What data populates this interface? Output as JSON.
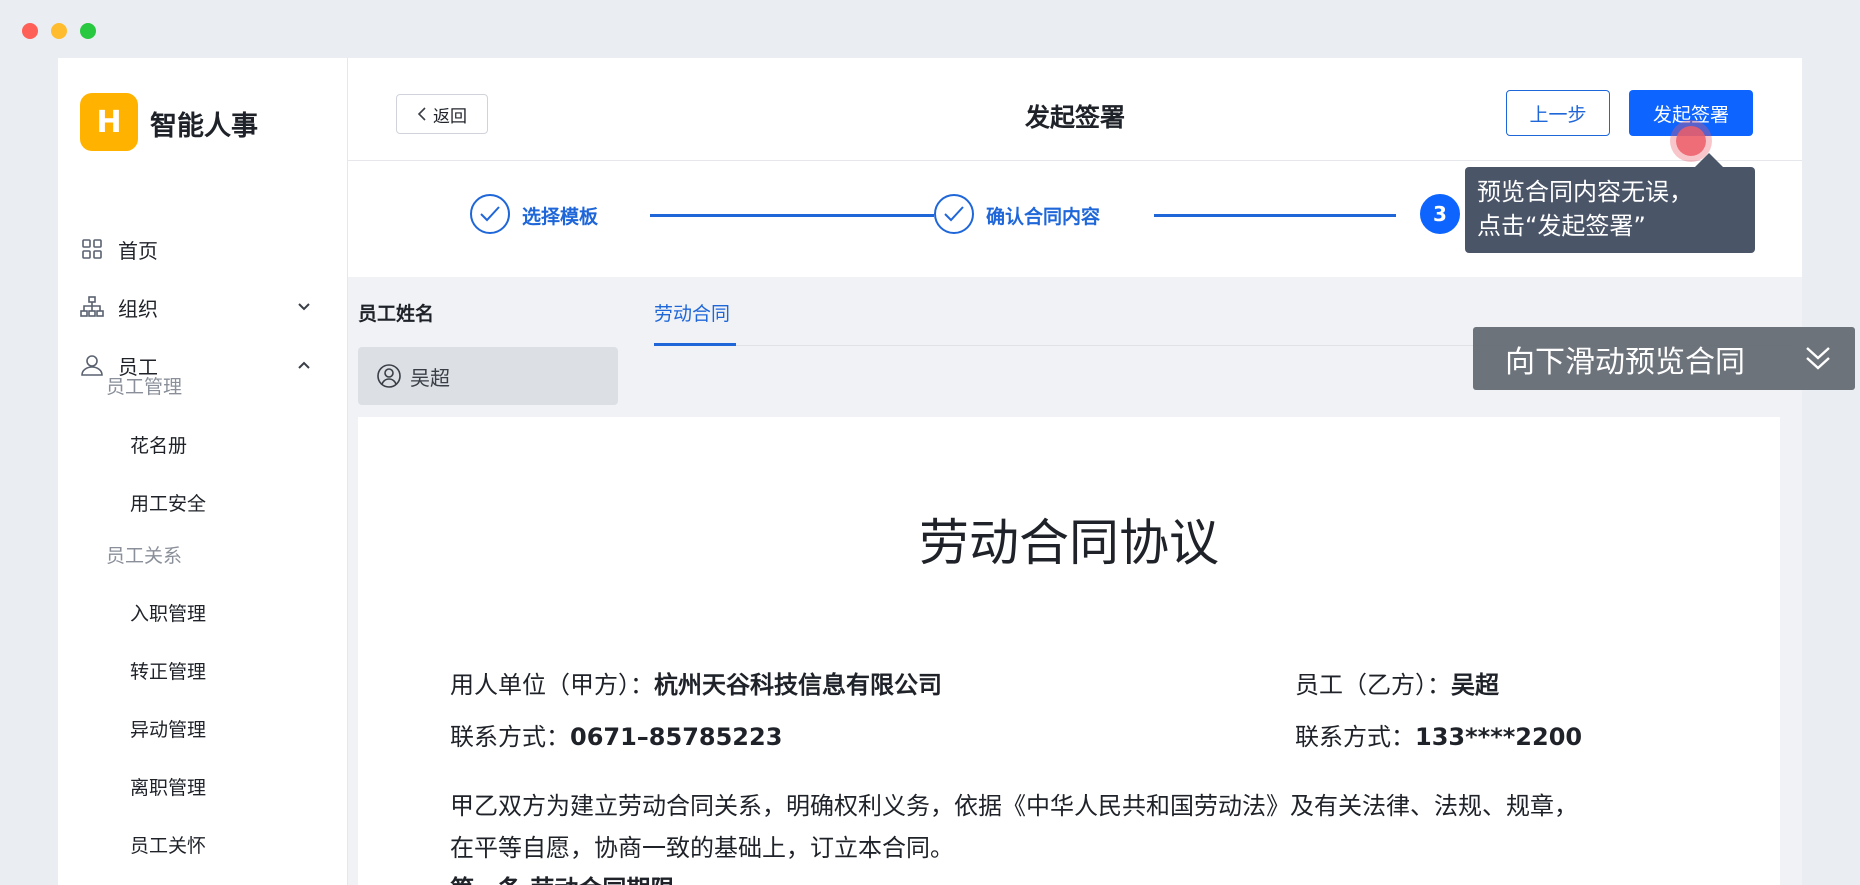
{
  "app": {
    "logo_letter": "H",
    "name": "智能人事",
    "brand_color": "#ffb300",
    "accent": "#1f67d9"
  },
  "sidebar": {
    "home": "首页",
    "org": "组织",
    "employee": "员工",
    "group_manage": "员工管理",
    "roster": "花名册",
    "safety": "用工安全",
    "group_relation": "员工关系",
    "onboard": "入职管理",
    "regular": "转正管理",
    "transfer": "异动管理",
    "leave": "离职管理",
    "care": "员工关怀"
  },
  "header": {
    "back": "返回",
    "title": "发起签署",
    "prev": "上一步",
    "submit": "发起签署"
  },
  "steps": {
    "s1": "选择模板",
    "s2": "确认合同内容",
    "s3_number": "3"
  },
  "tooltip": {
    "line1": "预览合同内容无误，",
    "line2": "点击“发起签署”"
  },
  "scroll_hint": "向下滑动预览合同",
  "content": {
    "col_emp": "员工姓名",
    "tab": "劳动合同",
    "employee": "吴超"
  },
  "doc": {
    "title": "劳动合同协议",
    "party_a_label": "用人单位（甲方）：",
    "party_a": "杭州天谷科技信息有限公司",
    "party_b_label": "员工（乙方）：",
    "party_b": "吴超",
    "contact_a_label": "联系方式：",
    "contact_a": "0671–85785223",
    "contact_b_label": "联系方式：",
    "contact_b": "133****2200",
    "para_line1": "甲乙双方为建立劳动合同关系，明确权利义务，依据《中华人民共和国劳动法》及有关法律、法规、规章，",
    "para_line2": "在平等自愿，协商一致的基础上，订立本合同。",
    "section1": "第一条 劳动合同期限"
  }
}
